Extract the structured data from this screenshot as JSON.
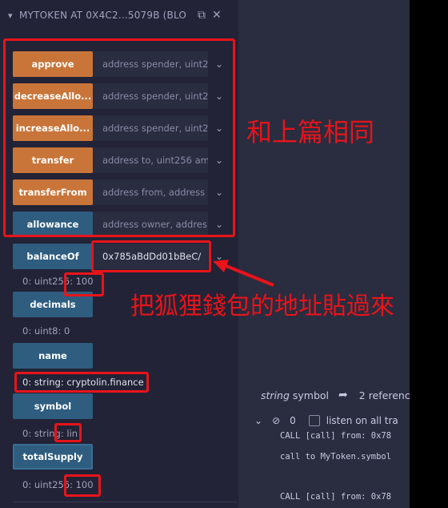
{
  "contract": {
    "title": "MYTOKEN AT 0X4C2...5079B (BLO",
    "caret": "▾",
    "copy_icon": "copy-icon",
    "close_icon": "close-icon"
  },
  "functions": [
    {
      "label": "approve",
      "placeholder": "address spender, uint2",
      "value": "",
      "color": "orange"
    },
    {
      "label": "decreaseAllo...",
      "placeholder": "address spender, uint2",
      "value": "",
      "color": "orange"
    },
    {
      "label": "increaseAllo...",
      "placeholder": "address spender, uint2",
      "value": "",
      "color": "orange"
    },
    {
      "label": "transfer",
      "placeholder": "address to, uint256 am",
      "value": "",
      "color": "orange"
    },
    {
      "label": "transferFrom",
      "placeholder": "address from, address",
      "value": "",
      "color": "orange"
    },
    {
      "label": "allowance",
      "placeholder": "address owner, addres",
      "value": "",
      "color": "blue"
    },
    {
      "label": "balanceOf",
      "placeholder": "",
      "value": "0x785aBdDd01bBeC/",
      "color": "blue"
    }
  ],
  "calls": [
    {
      "label": "decimals"
    },
    {
      "label": "name"
    },
    {
      "label": "symbol"
    },
    {
      "label": "totalSupply"
    }
  ],
  "results": {
    "balanceOf": "0: uint256: 100",
    "decimals": "0: uint8: 0",
    "name": "0: string: cryptolin.finance",
    "symbol": "0: string: lin",
    "totalSupply": "0: uint256: 100"
  },
  "annotations": {
    "same_as_previous": "和上篇相同",
    "paste_address": "把狐狸錢包的地址貼過來"
  },
  "right_panel": {
    "ref_type": "string",
    "ref_name": "symbol",
    "ref_count": "2 referenc",
    "term_count": "0",
    "listen_label": "listen on all tra",
    "log_lines": [
      "CALL   [call]  from: 0x78",
      "call to MyToken.symbol",
      "CALL   [call]  from: 0x78"
    ]
  },
  "colors": {
    "orange_button": "#c97539",
    "blue_button": "#2e5d7f",
    "annotation_red": "#e8141a"
  }
}
